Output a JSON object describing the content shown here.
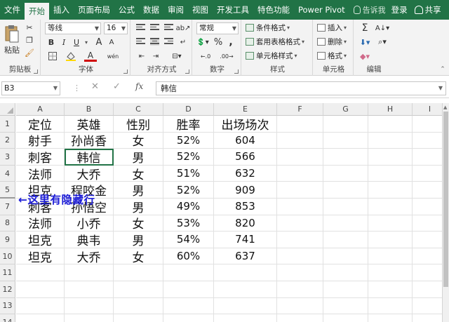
{
  "menubar": {
    "tabs": [
      "文件",
      "开始",
      "插入",
      "页面布局",
      "公式",
      "数据",
      "审阅",
      "视图",
      "开发工具",
      "特色功能",
      "Power Pivot"
    ],
    "active_tab": 1,
    "tell_me": "告诉我",
    "login": "登录",
    "share": "共享",
    "accent_color": "#217346"
  },
  "ribbon": {
    "clipboard": {
      "label": "剪贴板",
      "paste": "粘贴"
    },
    "font": {
      "label": "字体",
      "name": "等线",
      "size": "16",
      "bold": "B",
      "italic": "I",
      "underline": "U",
      "grow": "A",
      "shrink": "A",
      "font_color": "A",
      "phonetic": "wén"
    },
    "alignment": {
      "label": "对齐方式"
    },
    "number": {
      "label": "数字",
      "format": "常规",
      "percent": "%",
      "comma": ","
    },
    "styles": {
      "label": "样式",
      "conditional": "条件格式",
      "table": "套用表格格式",
      "cell_styles": "单元格样式"
    },
    "cells": {
      "label": "单元格",
      "insert": "插入",
      "delete": "删除",
      "format": "格式"
    },
    "editing": {
      "label": "编辑",
      "sum": "Σ"
    }
  },
  "formula_bar": {
    "name_box": "B3",
    "fx": "fx",
    "content": "韩信"
  },
  "grid": {
    "columns": [
      "A",
      "B",
      "C",
      "D",
      "E",
      "F",
      "G",
      "H",
      "I"
    ],
    "rows": [
      {
        "num": "1",
        "cells": [
          "定位",
          "英雄",
          "性别",
          "胜率",
          "出场场次"
        ]
      },
      {
        "num": "2",
        "cells": [
          "射手",
          "孙尚香",
          "女",
          "52%",
          "604"
        ]
      },
      {
        "num": "3",
        "cells": [
          "刺客",
          "韩信",
          "男",
          "52%",
          "566"
        ]
      },
      {
        "num": "4",
        "cells": [
          "法师",
          "大乔",
          "女",
          "51%",
          "632"
        ]
      },
      {
        "num": "5",
        "cells": [
          "坦克",
          "程咬金",
          "男",
          "52%",
          "909"
        ]
      },
      {
        "num": "7",
        "cells": [
          "刺客",
          "孙悟空",
          "男",
          "49%",
          "853"
        ]
      },
      {
        "num": "8",
        "cells": [
          "法师",
          "小乔",
          "女",
          "53%",
          "820"
        ]
      },
      {
        "num": "9",
        "cells": [
          "坦克",
          "典韦",
          "男",
          "54%",
          "741"
        ]
      },
      {
        "num": "10",
        "cells": [
          "坦克",
          "大乔",
          "女",
          "60%",
          "637"
        ]
      },
      {
        "num": "11",
        "cells": [
          "",
          "",
          "",
          "",
          ""
        ]
      },
      {
        "num": "12",
        "cells": [
          "",
          "",
          "",
          "",
          ""
        ]
      },
      {
        "num": "13",
        "cells": [
          "",
          "",
          "",
          "",
          ""
        ]
      },
      {
        "num": "14",
        "cells": [
          "",
          "",
          "",
          "",
          ""
        ]
      }
    ],
    "annotation": "←这里有隐藏行",
    "annotation_color": "#1b1bd6",
    "selected_cell": "B3"
  }
}
